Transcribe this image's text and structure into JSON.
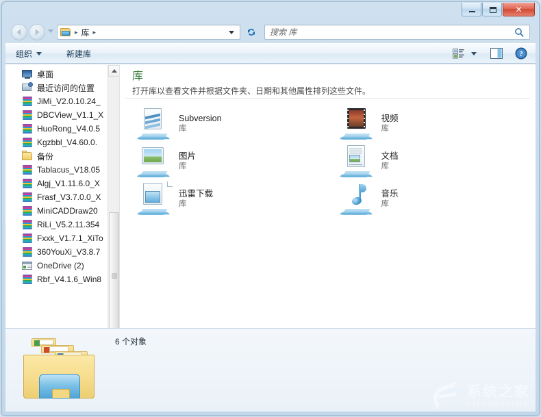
{
  "window": {
    "caption_buttons": [
      {
        "name": "minimize",
        "glyph": "—"
      },
      {
        "name": "maximize",
        "glyph": "❐"
      },
      {
        "name": "close",
        "glyph": "✕"
      }
    ]
  },
  "address_bar": {
    "icon": "libraries-folder-icon",
    "separator": "▸",
    "crumbs": [
      "库"
    ],
    "dropdown_icon": "chevron-down-icon",
    "refresh_icon": "refresh-icon"
  },
  "search": {
    "placeholder": "搜索 库",
    "value": "",
    "icon": "search-icon"
  },
  "toolbar": {
    "organize_label": "组织",
    "new_library_label": "新建库",
    "view_icon": "view-mode-icon",
    "view_caret_icon": "chevron-down-icon",
    "preview_pane_icon": "preview-pane-icon",
    "help_icon": "help-icon"
  },
  "sidebar": {
    "scroll_up_icon": "chevron-up-icon",
    "scroll_down_icon": "chevron-down-icon",
    "items": [
      {
        "label": "桌面",
        "icon": "desktop-icon",
        "type": "desktop"
      },
      {
        "label": "最近访问的位置",
        "icon": "recent-places-icon",
        "type": "recent"
      },
      {
        "label": "JiMi_V2.0.10.24_",
        "icon": "archive-icon",
        "type": "rar"
      },
      {
        "label": "DBCView_V1.1_X",
        "icon": "archive-icon",
        "type": "rar"
      },
      {
        "label": "HuoRong_V4.0.5",
        "icon": "archive-icon",
        "type": "rar"
      },
      {
        "label": "Kgzbbl_V4.60.0.",
        "icon": "archive-icon",
        "type": "rar"
      },
      {
        "label": "备份",
        "icon": "folder-icon",
        "type": "folder"
      },
      {
        "label": "Tablacus_V18.05",
        "icon": "archive-icon",
        "type": "rar"
      },
      {
        "label": "Algj_V1.11.6.0_X",
        "icon": "archive-icon",
        "type": "rar"
      },
      {
        "label": "Frasf_V3.7.0.0_X",
        "icon": "archive-icon",
        "type": "rar"
      },
      {
        "label": "MiniCADDraw20",
        "icon": "archive-icon",
        "type": "rar"
      },
      {
        "label": "RiLi_V5.2.11.354",
        "icon": "archive-icon",
        "type": "rar"
      },
      {
        "label": "Fxxk_V1.7.1_XiTo",
        "icon": "archive-icon",
        "type": "rar"
      },
      {
        "label": "360YouXi_V3.8.7",
        "icon": "archive-icon",
        "type": "rar"
      },
      {
        "label": "OneDrive (2)",
        "icon": "onedrive-icon",
        "type": "onedrive"
      },
      {
        "label": "Rbf_V4.1.6_Win8",
        "icon": "archive-icon",
        "type": "rar"
      }
    ]
  },
  "library_pane": {
    "title": "库",
    "description": "打开库以查看文件并根据文件夹、日期和其他属性排列这些文件。",
    "tiles": [
      {
        "name": "Subversion",
        "subtitle": "库",
        "icon": "subversion-library-icon",
        "icon_class": "ic-svn"
      },
      {
        "name": "视频",
        "subtitle": "库",
        "icon": "videos-library-icon",
        "icon_class": "ic-video"
      },
      {
        "name": "图片",
        "subtitle": "库",
        "icon": "pictures-library-icon",
        "icon_class": "ic-pic"
      },
      {
        "name": "文档",
        "subtitle": "库",
        "icon": "documents-library-icon",
        "icon_class": "ic-doc"
      },
      {
        "name": "迅雷下载",
        "subtitle": "库",
        "icon": "xunlei-download-library-icon",
        "icon_class": "ic-dl"
      },
      {
        "name": "音乐",
        "subtitle": "库",
        "icon": "music-library-icon",
        "icon_class": "ic-music"
      }
    ]
  },
  "details_pane": {
    "icon": "libraries-large-icon",
    "item_count": "6 个对象"
  },
  "watermark": {
    "chinese": "系统之家",
    "english": "XITONGZHIJIA"
  },
  "colors": {
    "library_title_green": "#3a7f3f",
    "close_button_red": "#cf4a32",
    "titlebar_blue": "#c3d7ea"
  }
}
